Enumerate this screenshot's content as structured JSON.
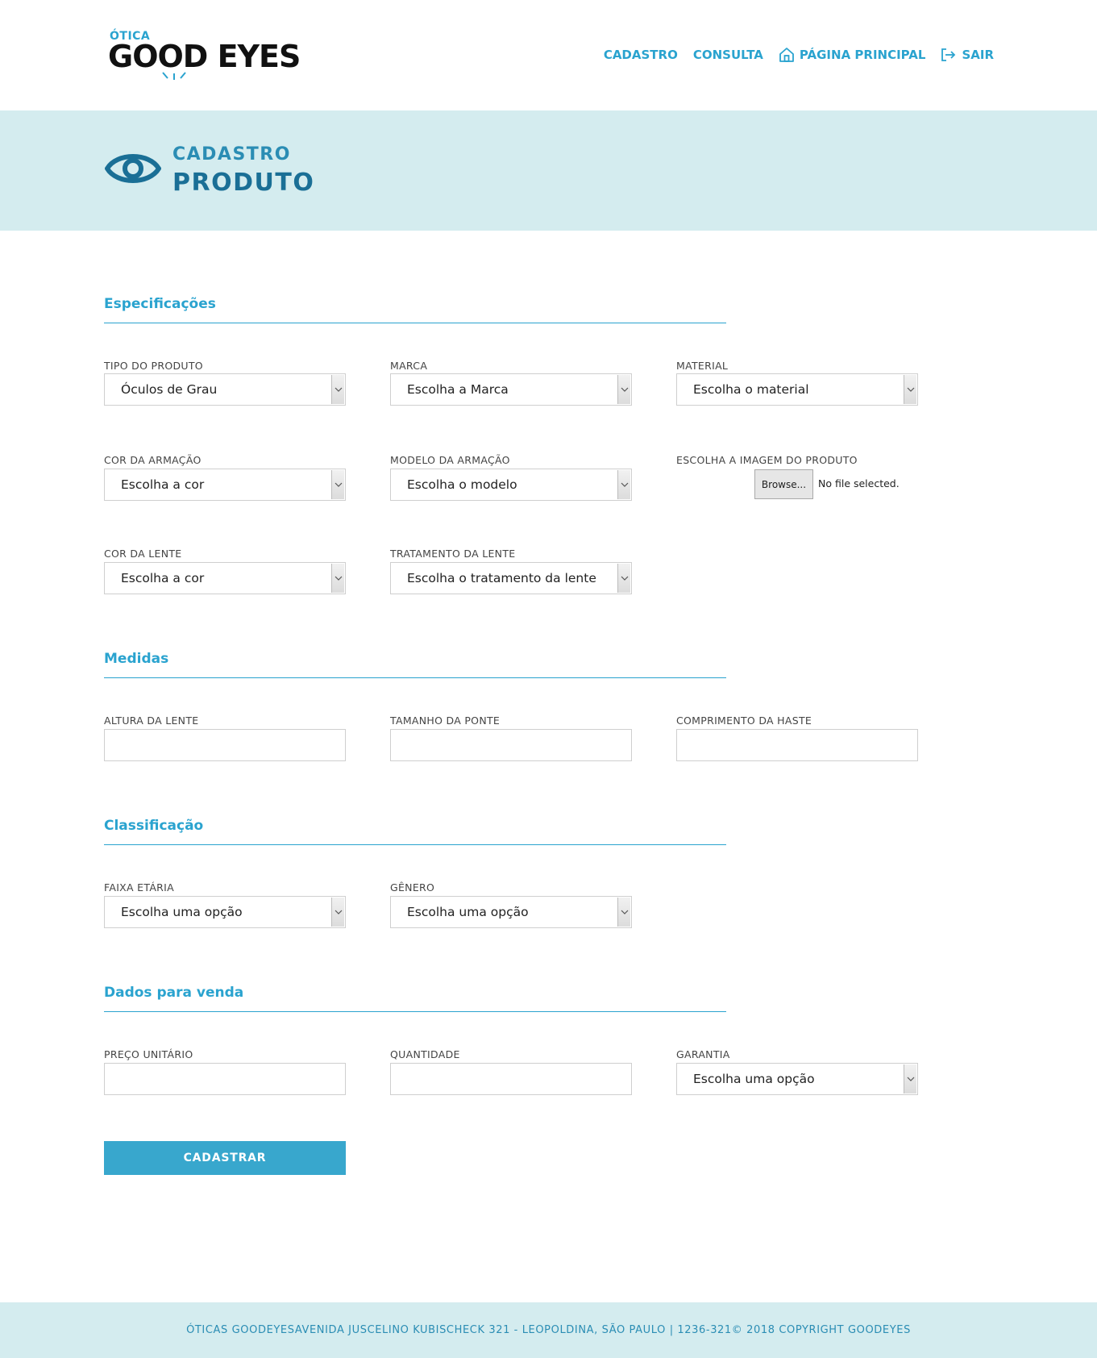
{
  "brand": {
    "small": "ÓTICA",
    "big": "GOOD EYES"
  },
  "nav": {
    "cadastro": "CADASTRO",
    "consulta": "CONSULTA",
    "home": "PÁGINA PRINCIPAL",
    "logout": "SAIR"
  },
  "banner": {
    "sup": "CADASTRO",
    "title": "PRODUTO"
  },
  "sections": {
    "specs": "Especificações",
    "measures": "Medidas",
    "classification": "Classificação",
    "sale": "Dados para venda"
  },
  "fields": {
    "tipo_produto": {
      "label": "TIPO DO PRODUTO",
      "value": "Óculos de Grau"
    },
    "marca": {
      "label": "MARCA",
      "value": "Escolha a Marca"
    },
    "material": {
      "label": "MATERIAL",
      "value": "Escolha o material"
    },
    "cor_armacao": {
      "label": "COR DA ARMAÇÃO",
      "value": "Escolha a cor"
    },
    "modelo_armacao": {
      "label": "MODELO DA ARMAÇÃO",
      "value": "Escolha o modelo"
    },
    "imagem": {
      "label": "ESCOLHA A IMAGEM DO PRODUTO",
      "button": "Browse...",
      "status": "No file selected."
    },
    "cor_lente": {
      "label": "COR DA LENTE",
      "value": "Escolha a cor"
    },
    "tratamento_lente": {
      "label": "TRATAMENTO DA LENTE",
      "value": "Escolha o tratamento da lente"
    },
    "altura_lente": {
      "label": "ALTURA DA LENTE",
      "value": ""
    },
    "tamanho_ponte": {
      "label": "TAMANHO DA PONTE",
      "value": ""
    },
    "comprimento_haste": {
      "label": "COMPRIMENTO DA HASTE",
      "value": ""
    },
    "faixa_etaria": {
      "label": "FAIXA ETÁRIA",
      "value": "Escolha uma opção"
    },
    "genero": {
      "label": "GÊNERO",
      "value": "Escolha uma opção"
    },
    "preco": {
      "label": "PREÇO UNITÁRIO",
      "value": ""
    },
    "quantidade": {
      "label": "QUANTIDADE",
      "value": ""
    },
    "garantia": {
      "label": "GARANTIA",
      "value": "Escolha uma opção"
    }
  },
  "submit_label": "CADASTRAR",
  "footer": "ÓTICAS GOODEYESAVENIDA JUSCELINO KUBISCHECK 321 - LEOPOLDINA, SÃO PAULO | 1236-321© 2018 COPYRIGHT GOODEYES",
  "colors": {
    "accent": "#2aa3cf",
    "banner_bg": "#d4ecef",
    "title_dark": "#1a6f96",
    "button_bg": "#38a7cd"
  },
  "icons": {
    "home": "home-icon",
    "logout": "logout-icon",
    "eye": "eye-icon",
    "select_arrow": "chevron-down-icon"
  }
}
